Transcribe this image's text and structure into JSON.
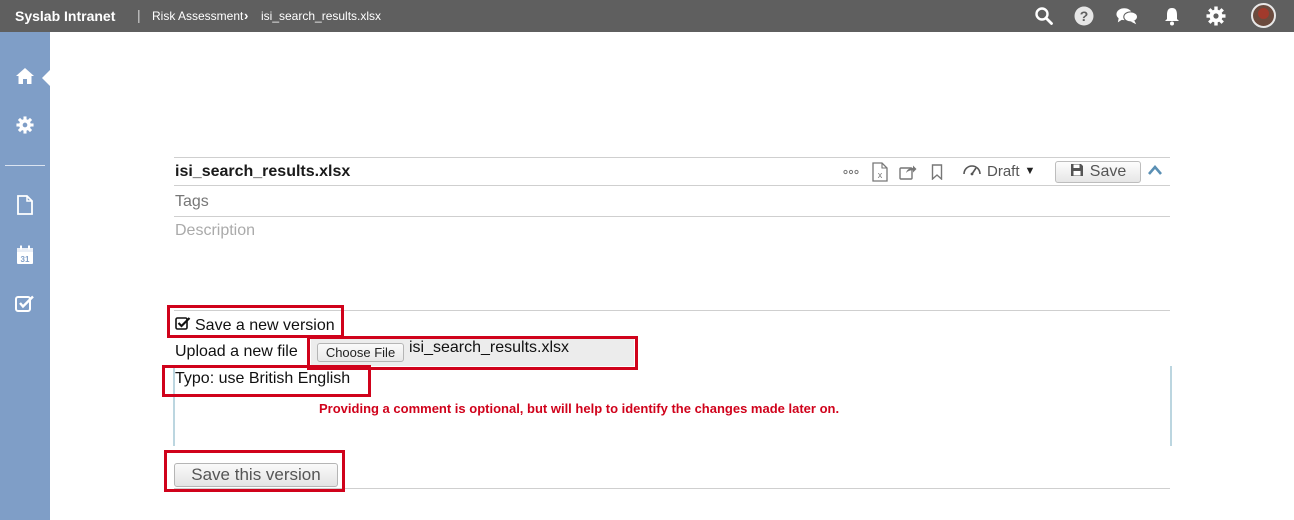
{
  "topbar": {
    "brand": "Syslab Intranet",
    "separator": "|",
    "breadcrumb": [
      "Risk Assessment",
      "isi_search_results.xlsx"
    ],
    "icons": [
      "search-icon",
      "help-icon",
      "chat-icon",
      "bell-icon",
      "gear-icon",
      "avatar"
    ]
  },
  "sidebar": {
    "items": [
      "home-icon",
      "gear-icon",
      "document-icon",
      "calendar-icon",
      "checkbox-icon"
    ],
    "calendar_day": "31"
  },
  "document": {
    "title": "isi_search_results.xlsx",
    "state": "Draft",
    "save_label": "Save",
    "tags_placeholder": "Tags",
    "description_placeholder": "Description"
  },
  "version_form": {
    "save_new_version_label": "Save a new version",
    "save_new_version_checked": true,
    "upload_label": "Upload a new file",
    "choose_file_label": "Choose File",
    "selected_file": "isi_search_results.xlsx",
    "comment": "Typo: use British English",
    "hint": "Providing a comment is optional, but will help to identify the changes made later on.",
    "submit_label": "Save this version"
  },
  "colors": {
    "topbar": "#5f5f5f",
    "sidebar": "#7f9ec7",
    "highlight": "#d0021b"
  }
}
